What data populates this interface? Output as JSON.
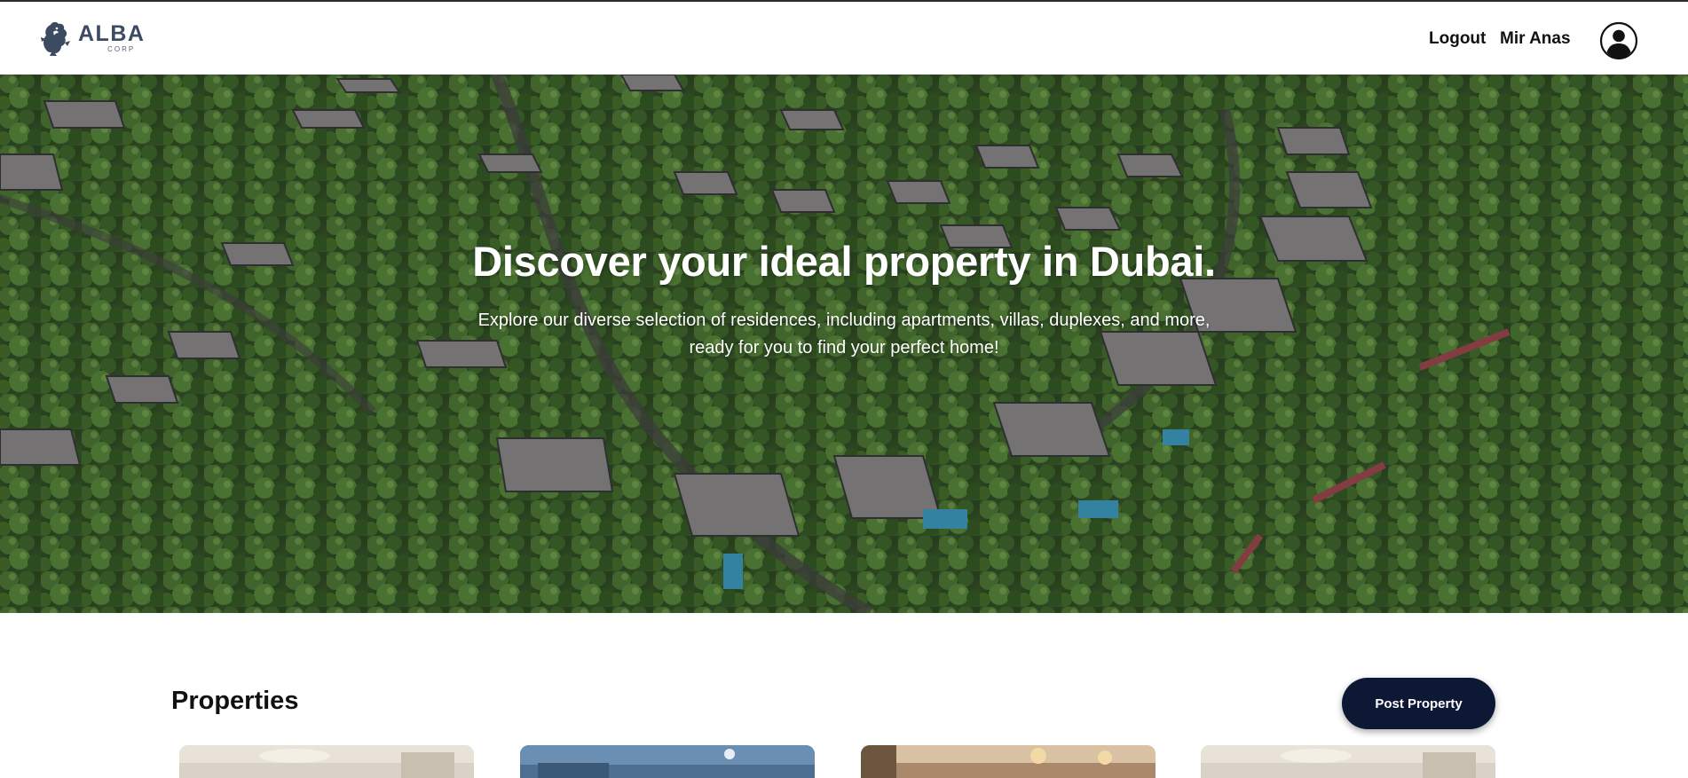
{
  "header": {
    "logo_word": "ALBA",
    "logo_sub": "CORP",
    "logout_label": "Logout",
    "user_name": "Mir Anas"
  },
  "hero": {
    "title": "Discover your ideal property in Dubai.",
    "subtitle": "Explore our diverse selection of residences, including apartments, villas, duplexes, and more, ready for you to find your perfect home!"
  },
  "properties": {
    "title": "Properties",
    "post_button": "Post Property",
    "cards": [
      {
        "image": "living-room-photo"
      },
      {
        "image": "bedroom-photo"
      },
      {
        "image": "lounge-photo"
      },
      {
        "image": "living-room-photo"
      }
    ]
  },
  "colors": {
    "primary_button": "#0c1834",
    "logo": "#3c4a62"
  }
}
